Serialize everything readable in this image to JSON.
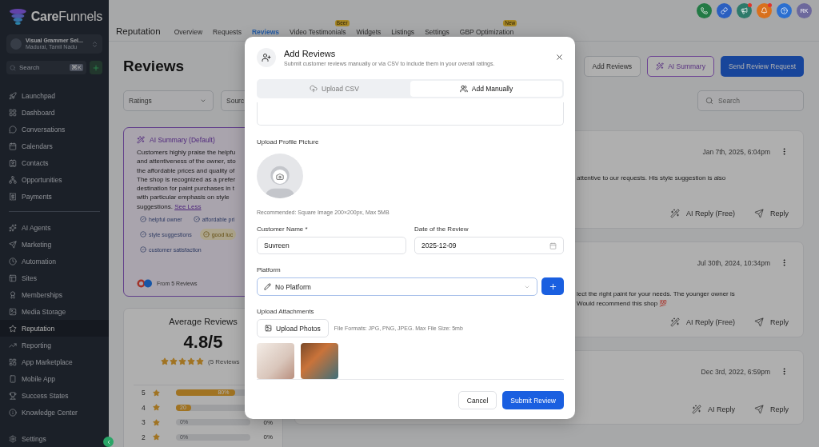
{
  "sidebar": {
    "logo": {
      "bold": "Care",
      "rest": "Funnels"
    },
    "account": {
      "name": "Visual Grammer Sel...",
      "location": "Madurai, Tamil Nadu"
    },
    "search": {
      "placeholder": "Search",
      "shortcut": "⌘K"
    },
    "groups": [
      [
        {
          "label": "Launchpad",
          "selected": false
        },
        {
          "label": "Dashboard",
          "selected": false
        },
        {
          "label": "Conversations",
          "selected": false
        },
        {
          "label": "Calendars",
          "selected": false
        },
        {
          "label": "Contacts",
          "selected": false
        },
        {
          "label": "Opportunities",
          "selected": false
        },
        {
          "label": "Payments",
          "selected": false
        }
      ],
      [
        {
          "label": "AI Agents",
          "selected": false
        },
        {
          "label": "Marketing",
          "selected": false
        },
        {
          "label": "Automation",
          "selected": false
        },
        {
          "label": "Sites",
          "selected": false
        },
        {
          "label": "Memberships",
          "selected": false
        },
        {
          "label": "Media Storage",
          "selected": false
        },
        {
          "label": "Reputation",
          "selected": true
        },
        {
          "label": "Reporting",
          "selected": false
        },
        {
          "label": "App Marketplace",
          "selected": false
        },
        {
          "label": "Mobile App",
          "selected": false
        },
        {
          "label": "Success States",
          "selected": false
        },
        {
          "label": "Knowledge Center",
          "selected": false
        }
      ]
    ],
    "footer": {
      "label": "Settings"
    }
  },
  "topbar": {
    "buttons": [
      {
        "color": "#237a45",
        "alert": false
      },
      {
        "color": "#2b5fc0",
        "alert": false
      },
      {
        "color": "#2e7a6a",
        "alert": true
      },
      {
        "color": "#d9701c",
        "alert": true
      },
      {
        "color": "#2b6fd0",
        "alert": false
      }
    ],
    "avatar": "RK"
  },
  "header": {
    "title": "Reputation",
    "tabs": [
      {
        "label": "Overview",
        "selected": false
      },
      {
        "label": "Requests",
        "selected": false
      },
      {
        "label": "Reviews",
        "selected": true
      },
      {
        "label": "Video Testimonials",
        "selected": false,
        "badge": "Beer"
      },
      {
        "label": "Widgets",
        "selected": false
      },
      {
        "label": "Listings",
        "selected": false
      },
      {
        "label": "Settings",
        "selected": false
      },
      {
        "label": "GBP Optimization",
        "selected": false,
        "badge": "New"
      }
    ]
  },
  "page": {
    "title": "Reviews",
    "actions": [
      {
        "label": "Add Reviews",
        "kind": "outline"
      },
      {
        "label": "AI Summary",
        "kind": "ai"
      },
      {
        "label": "Send Review Request",
        "kind": "primary"
      }
    ],
    "filters": [
      {
        "placeholder": "Ratings"
      },
      {
        "placeholder": "Sourc"
      }
    ],
    "search": {
      "placeholder": "Search"
    }
  },
  "summary": {
    "title": "AI Summary (Default)",
    "lines": [
      "Customers highly praise the helpfu",
      "and attentiveness of the owner, sto",
      "the affordable prices and quality of",
      "The shop is recognized as a prefer",
      "destination for paint purchases in t",
      "with particular emphasis on style"
    ],
    "last_line": "suggestions.",
    "link": "See Less",
    "tags": [
      {
        "label": "helpful owner",
        "kind": "positive"
      },
      {
        "label": "affordable pri",
        "kind": "positive"
      },
      {
        "label": "style suggestions",
        "kind": "positive"
      },
      {
        "label": "good luc",
        "kind": "neutral"
      },
      {
        "label": "customer satisfaction",
        "kind": "positive"
      }
    ],
    "source": "From 5 Reviews"
  },
  "average": {
    "title": "Average Reviews",
    "score": "4.8/5",
    "stars": 5,
    "count": "(5 Reviews",
    "rows": [
      {
        "rating": "5",
        "level": 0.8,
        "bar_label": "80%"
      },
      {
        "rating": "4",
        "level": 0.2,
        "bar_label": "20"
      },
      {
        "rating": "3",
        "bar_label": "0%",
        "value": "0%"
      },
      {
        "rating": "2",
        "bar_label": "0%",
        "value": "0%"
      }
    ]
  },
  "reviews": [
    {
      "date": "Jan 7th, 2025, 6:04pm",
      "lines": [
        "attentive to our requests. His style suggestion is also"
      ],
      "actions": [
        {
          "label": "AI Reply (Free)",
          "kind": "ai"
        },
        {
          "label": "Reply",
          "kind": "reply"
        }
      ]
    },
    {
      "date": "Jul 30th, 2024, 10:34pm",
      "lines": [
        "lect the right paint for your needs. The younger owner is",
        "Would recommend this shop 💯"
      ],
      "actions": [
        {
          "label": "AI Reply (Free)",
          "kind": "ai"
        },
        {
          "label": "Reply",
          "kind": "reply"
        }
      ]
    },
    {
      "date": "Dec 3rd, 2022, 6:59pm",
      "actions": [
        {
          "label": "AI Reply",
          "kind": "ai"
        },
        {
          "label": "Reply",
          "kind": "reply"
        }
      ]
    }
  ],
  "modal": {
    "title": "Add Reviews",
    "subtitle": "Submit customer reviews manually or via CSV to include them in your overall ratings.",
    "tabs": [
      {
        "label": "Upload CSV",
        "selected": false
      },
      {
        "label": "Add Manually",
        "selected": true
      }
    ],
    "profile": {
      "label": "Upload Profile Picture",
      "hint": "Recommended: Square Image 200×200px, Max 5MB"
    },
    "fields": [
      {
        "label": "Customer Name *",
        "value": "Suvreen",
        "kind": "text"
      },
      {
        "label": "Date of the Review",
        "value": "2025-12-09",
        "kind": "date"
      }
    ],
    "platform": {
      "label": "Platform",
      "value": "No Platform"
    },
    "attachments": {
      "label": "Upload Attachments",
      "button": "Upload Photos",
      "hint": "File Formats: JPG, PNG, JPEG. Max File Size: 5mb",
      "photos": [
        {
          "kind": "interior"
        },
        {
          "kind": "shelves"
        }
      ]
    },
    "buttons": [
      {
        "label": "Cancel",
        "kind": "secondary"
      },
      {
        "label": "Submit Review",
        "kind": "primary"
      }
    ]
  }
}
